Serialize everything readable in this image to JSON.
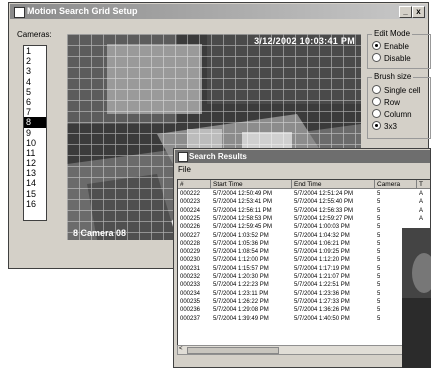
{
  "setup_window": {
    "title": "Motion Search Grid Setup",
    "min_glyph": "_",
    "close_glyph": "x",
    "cameras_label": "Cameras:",
    "cameras": [
      "1",
      "2",
      "3",
      "4",
      "5",
      "6",
      "7",
      "8",
      "9",
      "10",
      "11",
      "12",
      "13",
      "14",
      "15",
      "16"
    ],
    "selected_camera": "8",
    "video": {
      "timestamp": "3/12/2002 10:03:41 PM",
      "camera_label": "8 Camera 08"
    },
    "edit_mode": {
      "label": "Edit Mode",
      "options": [
        "Enable",
        "Disable"
      ],
      "selected": "Enable"
    },
    "brush_size": {
      "label": "Brush size",
      "options": [
        "Single cell",
        "Row",
        "Column",
        "3x3"
      ],
      "selected": "3x3"
    }
  },
  "results_window": {
    "title": "Search Results",
    "menu": [
      "File"
    ],
    "columns": [
      "#",
      "Start Time",
      "End Time",
      "Camera",
      "T"
    ],
    "rows": [
      {
        "n": "000222",
        "start": "5/7/2004 12:50:49 PM",
        "end": "5/7/2004 12:51:24 PM",
        "cam": "5",
        "t": "A"
      },
      {
        "n": "000223",
        "start": "5/7/2004 12:53:41 PM",
        "end": "5/7/2004 12:55:40 PM",
        "cam": "5",
        "t": "A"
      },
      {
        "n": "000224",
        "start": "5/7/2004 12:56:11 PM",
        "end": "5/7/2004 12:56:33 PM",
        "cam": "5",
        "t": "A"
      },
      {
        "n": "000225",
        "start": "5/7/2004 12:58:53 PM",
        "end": "5/7/2004 12:59:27 PM",
        "cam": "5",
        "t": "A"
      },
      {
        "n": "000226",
        "start": "5/7/2004 12:59:45 PM",
        "end": "5/7/2004 1:00:03 PM",
        "cam": "5",
        "t": ""
      },
      {
        "n": "000227",
        "start": "5/7/2004 1:03:52 PM",
        "end": "5/7/2004 1:04:32 PM",
        "cam": "5",
        "t": ""
      },
      {
        "n": "000228",
        "start": "5/7/2004 1:05:36 PM",
        "end": "5/7/2004 1:06:21 PM",
        "cam": "5",
        "t": ""
      },
      {
        "n": "000229",
        "start": "5/7/2004 1:08:54 PM",
        "end": "5/7/2004 1:09:25 PM",
        "cam": "5",
        "t": ""
      },
      {
        "n": "000230",
        "start": "5/7/2004 1:12:00 PM",
        "end": "5/7/2004 1:12:20 PM",
        "cam": "5",
        "t": ""
      },
      {
        "n": "000231",
        "start": "5/7/2004 1:15:57 PM",
        "end": "5/7/2004 1:17:19 PM",
        "cam": "5",
        "t": ""
      },
      {
        "n": "000232",
        "start": "5/7/2004 1:20:30 PM",
        "end": "5/7/2004 1:21:07 PM",
        "cam": "5",
        "t": ""
      },
      {
        "n": "000233",
        "start": "5/7/2004 1:22:23 PM",
        "end": "5/7/2004 1:22:51 PM",
        "cam": "5",
        "t": ""
      },
      {
        "n": "000234",
        "start": "5/7/2004 1:23:11 PM",
        "end": "5/7/2004 1:23:36 PM",
        "cam": "5",
        "t": ""
      },
      {
        "n": "000235",
        "start": "5/7/2004 1:26:22 PM",
        "end": "5/7/2004 1:27:33 PM",
        "cam": "5",
        "t": ""
      },
      {
        "n": "000236",
        "start": "5/7/2004 1:29:08 PM",
        "end": "5/7/2004 1:36:26 PM",
        "cam": "5",
        "t": ""
      },
      {
        "n": "000237",
        "start": "5/7/2004 1:39:49 PM",
        "end": "5/7/2004 1:40:50 PM",
        "cam": "5",
        "t": ""
      }
    ],
    "scroll_left_glyph": "<"
  }
}
